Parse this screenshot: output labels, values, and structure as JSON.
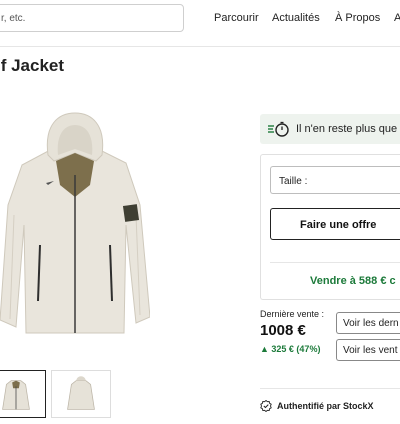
{
  "search": {
    "placeholder": "r, etc."
  },
  "nav": {
    "items": [
      {
        "label": "Parcourir"
      },
      {
        "label": "Actualités"
      },
      {
        "label": "À Propos"
      },
      {
        "label": "A"
      }
    ]
  },
  "product": {
    "title": "lf Jacket",
    "image": {
      "subject": "light beige hooded jacket with olive lining and shoulder badge"
    }
  },
  "stock": {
    "text": "Il n'en reste plus que"
  },
  "buy_panel": {
    "size_label": "Taille :",
    "offer_label": "Faire une offre",
    "sell_label": "Vendre à 588 € c"
  },
  "last_sale": {
    "label": "Dernière vente :",
    "price": "1008 €",
    "change": "▲ 325 € (47%)",
    "btn_1": "Voir les dern",
    "btn_2": "Voir les vent"
  },
  "auth": {
    "text": "Authentifié par StockX"
  },
  "colors": {
    "accent_green": "#1c7a3a",
    "banner_bg": "#eef3ee"
  }
}
